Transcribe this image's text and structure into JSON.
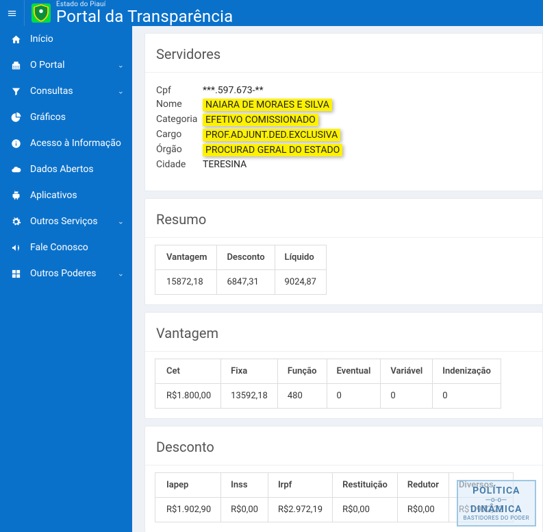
{
  "brand": {
    "small": "Estado do Piauí",
    "large": "Portal da Transparência"
  },
  "sidebar": {
    "items": [
      {
        "label": "Início",
        "icon": "home-icon",
        "hasSub": false
      },
      {
        "label": "O Portal",
        "icon": "building-icon",
        "hasSub": true
      },
      {
        "label": "Consultas",
        "icon": "filter-icon",
        "hasSub": true
      },
      {
        "label": "Gráficos",
        "icon": "chart-icon",
        "hasSub": false
      },
      {
        "label": "Acesso à Informação",
        "icon": "info-icon",
        "hasSub": false
      },
      {
        "label": "Dados Abertos",
        "icon": "cloud-icon",
        "hasSub": false
      },
      {
        "label": "Aplicativos",
        "icon": "android-icon",
        "hasSub": false
      },
      {
        "label": "Outros Serviços",
        "icon": "gear-icon",
        "hasSub": true
      },
      {
        "label": "Fale Conosco",
        "icon": "bullhorn-icon",
        "hasSub": false
      },
      {
        "label": "Outros Poderes",
        "icon": "grid-icon",
        "hasSub": true
      }
    ]
  },
  "sections": {
    "servidores": {
      "title": "Servidores",
      "labels": {
        "cpf": "Cpf",
        "nome": "Nome",
        "categoria": "Categoria",
        "cargo": "Cargo",
        "orgao": "Órgão",
        "cidade": "Cidade"
      },
      "values": {
        "cpf": "***.597.673-**",
        "nome": "NAIARA DE MORAES E SILVA",
        "categoria": "EFETIVO COMISSIONADO",
        "cargo": "PROF.ADJUNT.DED.EXCLUSIVA",
        "orgao": "PROCURAD GERAL DO ESTADO",
        "cidade": "TERESINA"
      }
    },
    "resumo": {
      "title": "Resumo",
      "headers": [
        "Vantagem",
        "Desconto",
        "Líquido"
      ],
      "row": [
        "15872,18",
        "6847,31",
        "9024,87"
      ]
    },
    "vantagem": {
      "title": "Vantagem",
      "headers": [
        "Cet",
        "Fixa",
        "Função",
        "Eventual",
        "Variável",
        "Indenização"
      ],
      "row": [
        "R$1.800,00",
        "13592,18",
        "480",
        "0",
        "0",
        "0"
      ]
    },
    "desconto": {
      "title": "Desconto",
      "headers": [
        "Iapep",
        "Inss",
        "Irpf",
        "Restituição",
        "Redutor",
        "Diversos"
      ],
      "row": [
        "R$1.902,90",
        "R$0,00",
        "R$2.972,19",
        "R$0,00",
        "R$0,00",
        "R$1.972,22"
      ]
    }
  },
  "watermark": {
    "line1": "POLÍTICA",
    "line2": "DINÂMICA",
    "foot": "BASTIDORES DO PODER"
  }
}
